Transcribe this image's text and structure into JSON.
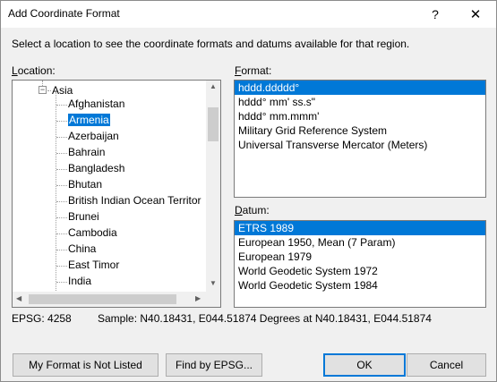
{
  "window": {
    "title": "Add Coordinate Format",
    "help_glyph": "?",
    "close_glyph": "✕"
  },
  "instruction": "Select a location to see the coordinate formats and datums available for that region.",
  "location": {
    "label": "Location:",
    "root": "Asia",
    "items": [
      "Afghanistan",
      "Armenia",
      "Azerbaijan",
      "Bahrain",
      "Bangladesh",
      "Bhutan",
      "British Indian Ocean Territor",
      "Brunei",
      "Cambodia",
      "China",
      "East Timor",
      "India"
    ],
    "selected": "Armenia"
  },
  "format": {
    "label": "Format:",
    "items": [
      "hddd.ddddd°",
      "hddd° mm' ss.s\"",
      "hddd° mm.mmm'",
      "Military Grid Reference System",
      "Universal Transverse Mercator (Meters)"
    ],
    "selected": "hddd.ddddd°"
  },
  "datum": {
    "label": "Datum:",
    "items": [
      "ETRS 1989",
      "European 1950, Mean (7 Param)",
      "European 1979",
      "World Geodetic System 1972",
      "World Geodetic System 1984"
    ],
    "selected": "ETRS 1989"
  },
  "status": {
    "epsg": "EPSG: 4258",
    "sample": "Sample: N40.18431, E044.51874 Degrees at N40.18431, E044.51874"
  },
  "buttons": {
    "not_listed": "My Format is Not Listed",
    "find_epsg": "Find by EPSG...",
    "ok": "OK",
    "cancel": "Cancel"
  }
}
